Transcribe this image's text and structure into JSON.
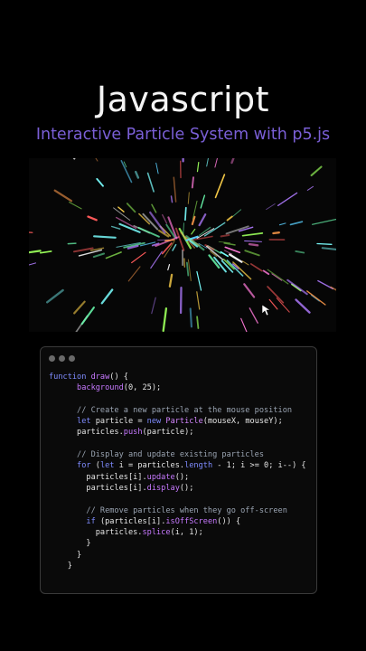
{
  "header": {
    "title": "Javascript",
    "subtitle": "Interactive Particle System with p5.js"
  },
  "colors": {
    "background": "#000000",
    "subtitle": "#7a5fd6",
    "keyword": "#7f8cff",
    "function": "#c779ff",
    "comment": "#9aa4b2",
    "editor_bg": "#0a0a0a"
  },
  "editor": {
    "window_dots": [
      "dot",
      "dot",
      "dot"
    ],
    "code_lines": [
      [
        {
          "t": "function ",
          "c": "kw"
        },
        {
          "t": "draw",
          "c": "fn"
        },
        {
          "t": "() {",
          "c": "tx"
        }
      ],
      [
        {
          "t": "      ",
          "c": "tx"
        },
        {
          "t": "background",
          "c": "fn"
        },
        {
          "t": "(0, 25);",
          "c": "tx"
        }
      ],
      [],
      [
        {
          "t": "      // Create a new particle at the mouse position",
          "c": "cm"
        }
      ],
      [
        {
          "t": "      ",
          "c": "tx"
        },
        {
          "t": "let",
          "c": "kw"
        },
        {
          "t": " particle = ",
          "c": "tx"
        },
        {
          "t": "new",
          "c": "kw"
        },
        {
          "t": " ",
          "c": "tx"
        },
        {
          "t": "Particle",
          "c": "cl"
        },
        {
          "t": "(mouseX, mouseY);",
          "c": "tx"
        }
      ],
      [
        {
          "t": "      particles.",
          "c": "tx"
        },
        {
          "t": "push",
          "c": "fn"
        },
        {
          "t": "(particle);",
          "c": "tx"
        }
      ],
      [],
      [
        {
          "t": "      // Display and update existing particles",
          "c": "cm"
        }
      ],
      [
        {
          "t": "      ",
          "c": "tx"
        },
        {
          "t": "for",
          "c": "kw"
        },
        {
          "t": " (",
          "c": "tx"
        },
        {
          "t": "let",
          "c": "kw"
        },
        {
          "t": " i = particles.",
          "c": "tx"
        },
        {
          "t": "length",
          "c": "kw"
        },
        {
          "t": " - 1; i >= 0; i--) {",
          "c": "tx"
        }
      ],
      [
        {
          "t": "        particles[i].",
          "c": "tx"
        },
        {
          "t": "update",
          "c": "fn"
        },
        {
          "t": "();",
          "c": "tx"
        }
      ],
      [
        {
          "t": "        particles[i].",
          "c": "tx"
        },
        {
          "t": "display",
          "c": "fn"
        },
        {
          "t": "();",
          "c": "tx"
        }
      ],
      [],
      [
        {
          "t": "        // Remove particles when they go off-screen",
          "c": "cm"
        }
      ],
      [
        {
          "t": "        ",
          "c": "tx"
        },
        {
          "t": "if",
          "c": "kw"
        },
        {
          "t": " (particles[i].",
          "c": "tx"
        },
        {
          "t": "isOffScreen",
          "c": "fn"
        },
        {
          "t": "()) {",
          "c": "tx"
        }
      ],
      [
        {
          "t": "          particles.",
          "c": "tx"
        },
        {
          "t": "splice",
          "c": "fn"
        },
        {
          "t": "(i, 1);",
          "c": "tx"
        }
      ],
      [
        {
          "t": "        }",
          "c": "tx"
        }
      ],
      [
        {
          "t": "      }",
          "c": "tx"
        }
      ],
      [
        {
          "t": "    }",
          "c": "tx"
        }
      ]
    ]
  },
  "particle_palette": [
    "#ff5a5a",
    "#ffd24a",
    "#6bffb0",
    "#5ad0ff",
    "#b07bff",
    "#ff7ad9",
    "#ffffff",
    "#7affff",
    "#ff9a4a",
    "#9aff5a"
  ]
}
